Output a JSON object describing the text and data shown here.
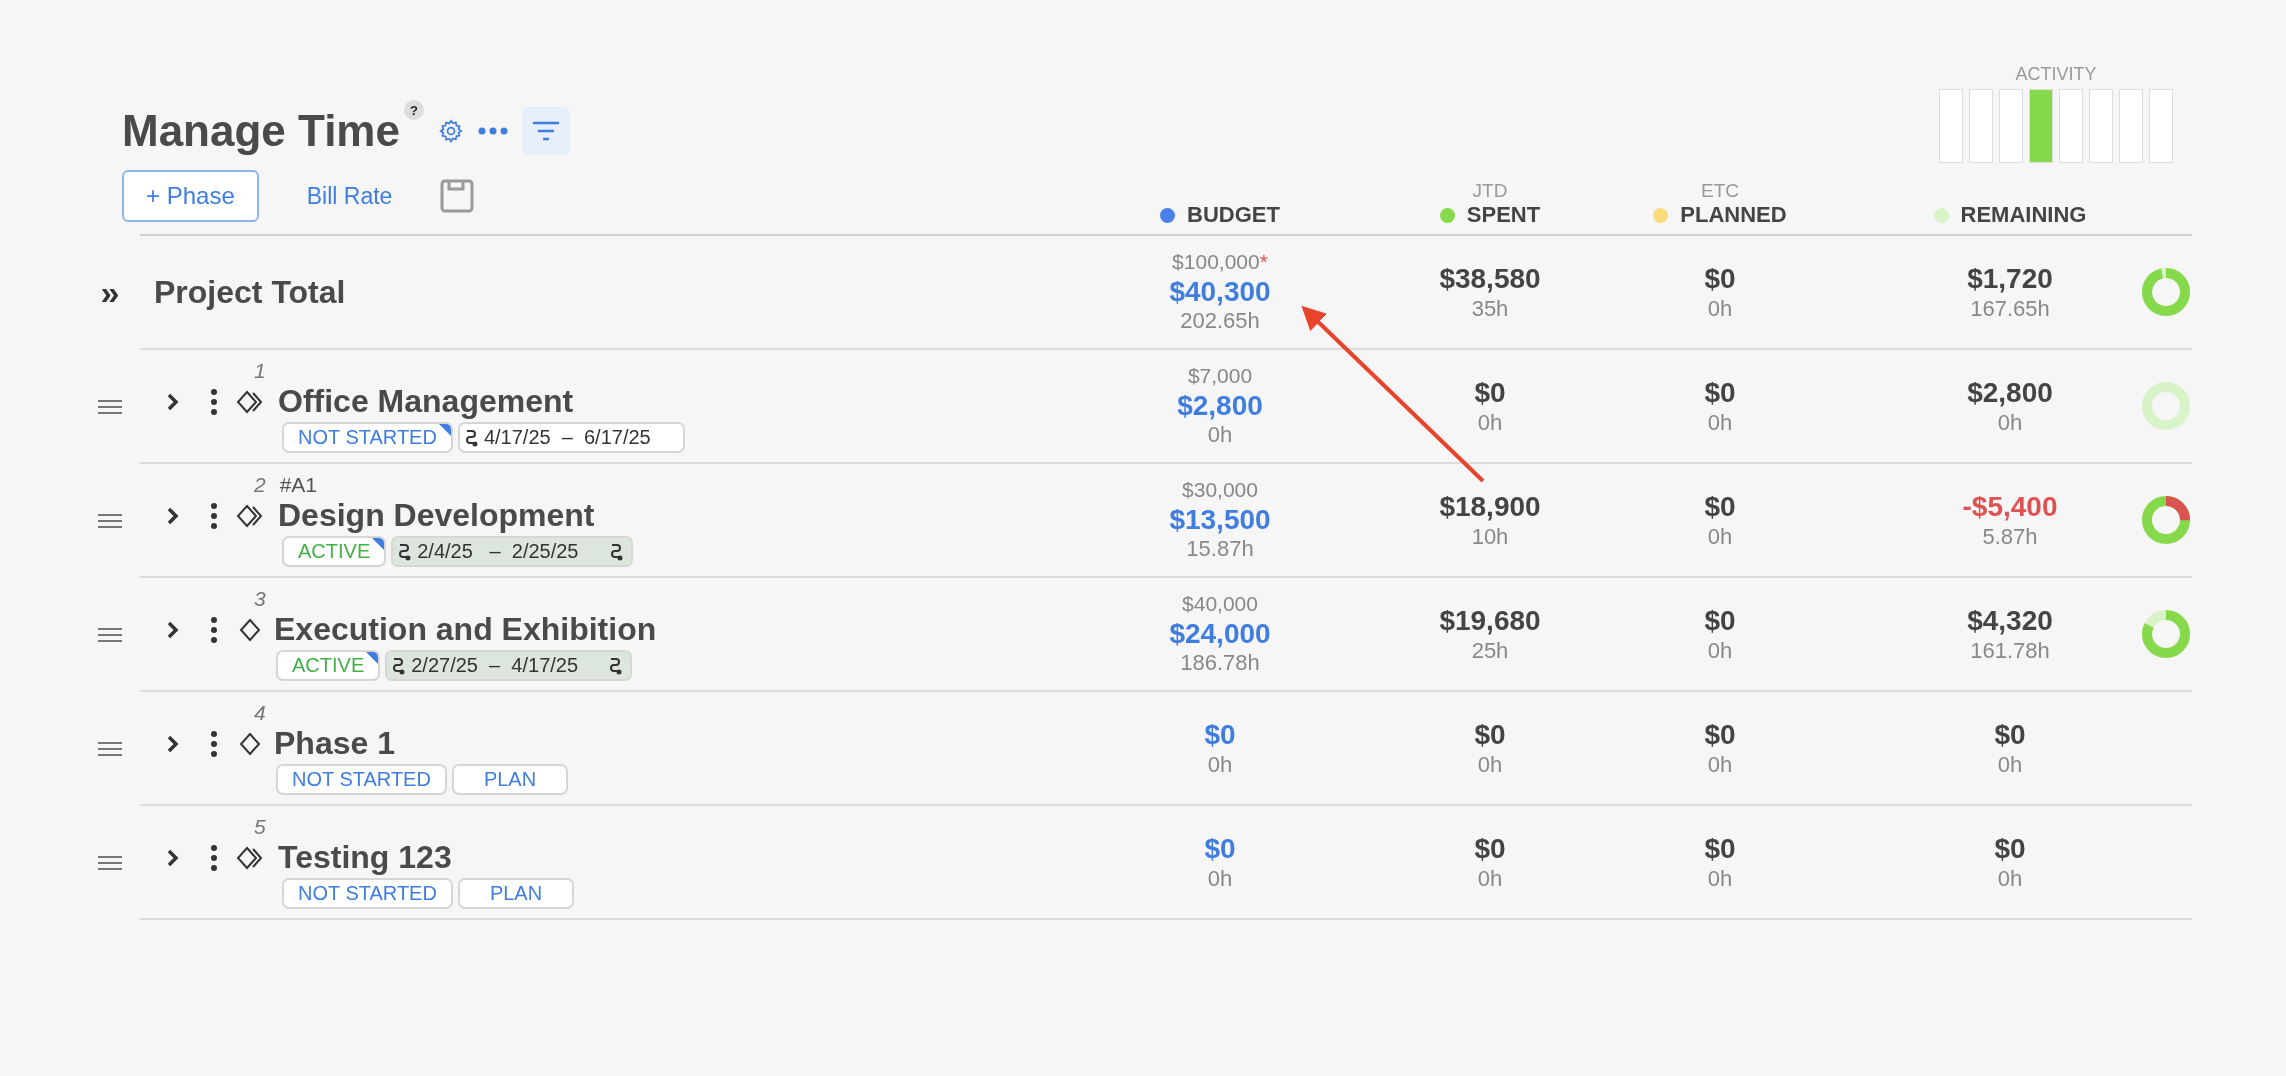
{
  "header": {
    "title": "Manage Time",
    "help": "?",
    "filter_active": true,
    "add_button": "+ Phase",
    "bill_rate_link": "Bill Rate"
  },
  "activity": {
    "label": "ACTIVITY",
    "bars": [
      {
        "on": false
      },
      {
        "on": false
      },
      {
        "on": false
      },
      {
        "on": true
      },
      {
        "on": false
      },
      {
        "on": false
      },
      {
        "on": false
      },
      {
        "on": false
      }
    ]
  },
  "columns": [
    {
      "label": "BUDGET",
      "color": "#4a80e8"
    },
    {
      "over": "JTD",
      "label": "SPENT",
      "color": "#86d94a"
    },
    {
      "over": "ETC",
      "label": "PLANNED",
      "color": "#f8dc7c"
    },
    {
      "label": "REMAINING",
      "color": "#d8f3c8"
    }
  ],
  "total": {
    "toggle": "»",
    "label": "Project Total",
    "cells": [
      {
        "cap": "$100,000",
        "cap_mark": "*",
        "amount": "$40,300",
        "hours": "202.65h"
      },
      {
        "amount": "$38,580",
        "hours": "35h"
      },
      {
        "amount": "$0",
        "hours": "0h"
      },
      {
        "amount": "$1,720",
        "hours": "167.65h",
        "negative": false
      }
    ],
    "donut": {
      "level": 0.96,
      "overrun": false
    }
  },
  "phases": [
    {
      "number": "1",
      "name": "Office Management",
      "kind": "linked",
      "tags": [
        {
          "kind": "not_started",
          "text": "NOT STARTED",
          "flagged": true
        },
        {
          "kind": "dates",
          "range": "4/17/25  –  6/17/25",
          "shaded": false
        }
      ],
      "cells": [
        {
          "cap": "$7,000",
          "amount": "$2,800",
          "hours": "0h"
        },
        {
          "amount": "$0",
          "hours": "0h"
        },
        {
          "amount": "$0",
          "hours": "0h"
        },
        {
          "amount": "$2,800",
          "hours": "0h",
          "negative": false
        }
      ],
      "donut": {
        "level": 0,
        "overrun": false
      }
    },
    {
      "number": "2",
      "code": "#A1",
      "name": "Design Development",
      "kind": "linked",
      "tags": [
        {
          "kind": "active",
          "text": "ACTIVE",
          "flagged": true
        },
        {
          "kind": "dates",
          "range": "2/4/25   –  2/25/25",
          "shaded": true
        }
      ],
      "cells": [
        {
          "cap": "$30,000",
          "amount": "$13,500",
          "hours": "15.87h"
        },
        {
          "amount": "$18,900",
          "hours": "10h"
        },
        {
          "amount": "$0",
          "hours": "0h"
        },
        {
          "amount": "-$5,400",
          "hours": "5.87h",
          "negative": true
        }
      ],
      "donut": {
        "level": 0.25,
        "overrun": true
      }
    },
    {
      "number": "3",
      "name": "Execution and Exhibition",
      "kind": "plain",
      "tags": [
        {
          "kind": "active",
          "text": "ACTIVE",
          "flagged": true
        },
        {
          "kind": "dates",
          "range": "2/27/25  –  4/17/25",
          "shaded": true
        }
      ],
      "cells": [
        {
          "cap": "$40,000",
          "amount": "$24,000",
          "hours": "186.78h"
        },
        {
          "amount": "$19,680",
          "hours": "25h"
        },
        {
          "amount": "$0",
          "hours": "0h"
        },
        {
          "amount": "$4,320",
          "hours": "161.78h",
          "negative": false
        }
      ],
      "donut": {
        "level": 0.82,
        "overrun": false
      }
    },
    {
      "number": "4",
      "name": "Phase 1",
      "kind": "plain",
      "tags": [
        {
          "kind": "not_started",
          "text": "NOT STARTED",
          "flagged": false
        },
        {
          "kind": "plan",
          "text": "PLAN"
        }
      ],
      "cells": [
        {
          "amount": "$0",
          "hours": "0h"
        },
        {
          "amount": "$0",
          "hours": "0h"
        },
        {
          "amount": "$0",
          "hours": "0h"
        },
        {
          "amount": "$0",
          "hours": "0h",
          "negative": false
        }
      ]
    },
    {
      "number": "5",
      "name": "Testing 123",
      "kind": "linked",
      "tags": [
        {
          "kind": "not_started",
          "text": "NOT STARTED",
          "flagged": false
        },
        {
          "kind": "plan",
          "text": "PLAN"
        }
      ],
      "cells": [
        {
          "amount": "$0",
          "hours": "0h"
        },
        {
          "amount": "$0",
          "hours": "0h"
        },
        {
          "amount": "$0",
          "hours": "0h"
        },
        {
          "amount": "$0",
          "hours": "0h",
          "negative": false
        }
      ]
    }
  ]
}
